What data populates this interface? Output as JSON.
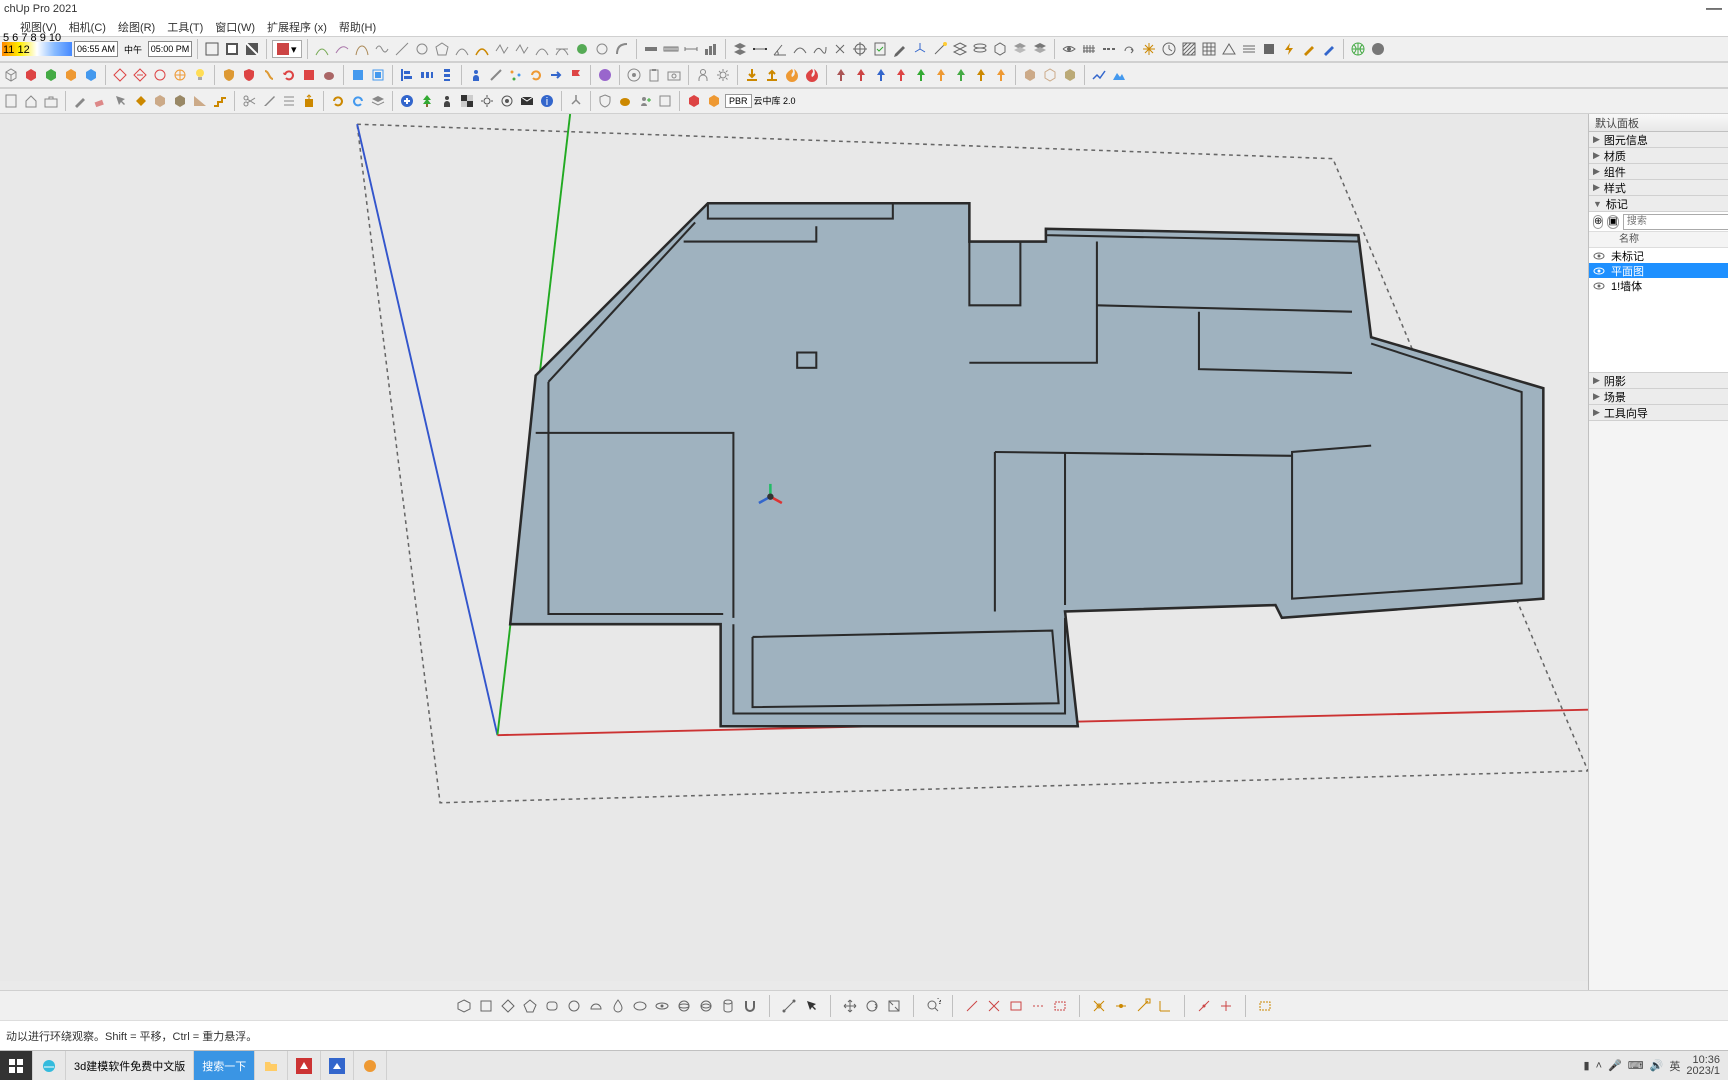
{
  "app": {
    "title": "chUp Pro 2021"
  },
  "menu": {
    "items": [
      "视图(V)",
      "相机(C)",
      "绘图(R)",
      "工具(T)",
      "窗口(W)",
      "扩展程序 (x)",
      "帮助(H)"
    ]
  },
  "time_bar": {
    "gradient_ticks": "5 6 7 8 9 10 11 12",
    "time_left": "06:55 AM",
    "mid": "中午",
    "time_right": "05:00 PM"
  },
  "right_panel": {
    "header": "默认面板",
    "sections": [
      "图元信息",
      "材质",
      "组件",
      "样式",
      "标记"
    ],
    "tags_search_ph": "搜索",
    "tags_col": "名称",
    "tags": [
      {
        "name": "未标记",
        "sel": false
      },
      {
        "name": "平面图",
        "sel": true
      },
      {
        "name": "1!墙体",
        "sel": false
      }
    ],
    "lower_sections": [
      "阴影",
      "场景",
      "工具向导"
    ]
  },
  "pbr_label": "云中库 2.0",
  "status": "动以进行环绕观察。Shift = 平移，Ctrl = 重力悬浮。",
  "taskbar": {
    "items": [
      {
        "id": "start",
        "label": ""
      },
      {
        "id": "ie",
        "label": ""
      },
      {
        "id": "browser-tab",
        "label": "3d建模软件免费中文版"
      },
      {
        "id": "search",
        "label": "搜索一下"
      },
      {
        "id": "explorer",
        "label": ""
      },
      {
        "id": "app-red",
        "label": ""
      },
      {
        "id": "app-su",
        "label": ""
      },
      {
        "id": "app-fox",
        "label": ""
      }
    ],
    "ime": "英",
    "clock_time": "10:36",
    "clock_date": "2023/1"
  }
}
